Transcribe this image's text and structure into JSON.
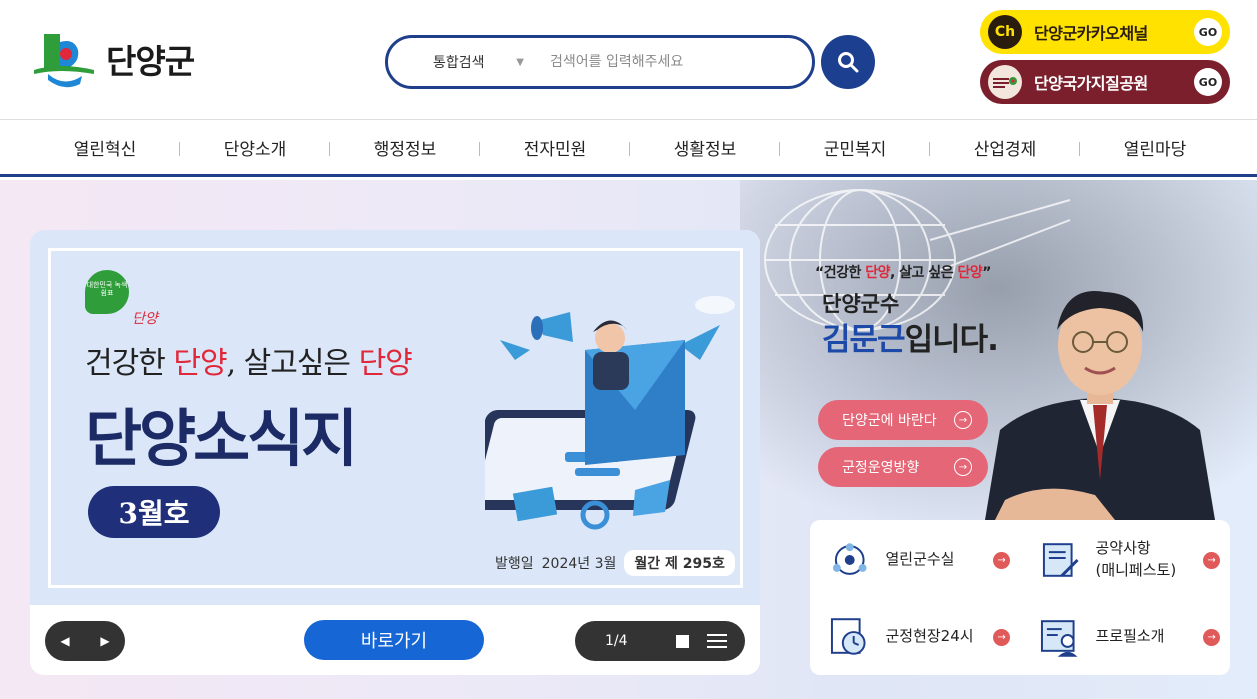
{
  "header": {
    "logo_text": "단양군",
    "search": {
      "category": "통합검색",
      "placeholder": "검색어를 입력해주세요"
    },
    "quick_links": [
      {
        "icon": "Ch",
        "label": "단양군카카오채널",
        "go": "GO"
      },
      {
        "icon": "단양세계지질공원",
        "label": "단양국가지질공원",
        "go": "GO"
      }
    ]
  },
  "nav": {
    "items": [
      "열린혁신",
      "단양소개",
      "행정정보",
      "전자민원",
      "생활정보",
      "군민복지",
      "산업경제",
      "열린마당"
    ]
  },
  "news": {
    "badge": "대한민국 녹색쉼표",
    "badge_sub": "단양",
    "slogan": {
      "p1": "건강한 ",
      "r1": "단양",
      "p2": ", 살고싶은 ",
      "r2": "단양"
    },
    "title": "단양소식지",
    "issue": "3월호",
    "pub_label": "발행일",
    "pub_date": "2024년 3월",
    "volume": "월간 제 295호",
    "goto_label": "바로가기",
    "pager": "1/4"
  },
  "mayor": {
    "quote": {
      "open": "“건강한 ",
      "r1": "단양",
      "mid": ", 살고 싶은 ",
      "r2": "단양",
      "close": "”"
    },
    "subtitle": "단양군수",
    "name_blue": "김문근",
    "name_rest": "입니다.",
    "buttons": [
      "단양군에 바란다",
      "군정운영방향"
    ]
  },
  "links": [
    {
      "label": "열린군수실",
      "icon": "people-circle-icon"
    },
    {
      "label": "공약사항\n(매니페스토)",
      "icon": "document-pen-icon"
    },
    {
      "label": "군정현장24시",
      "icon": "clock-icon"
    },
    {
      "label": "프로필소개",
      "icon": "profile-card-icon"
    }
  ],
  "colors": {
    "primary": "#1f3f8c",
    "kakao": "#ffe200",
    "geopark": "#7a1f2b",
    "accent_red": "#e0283a",
    "pill": "#e56676",
    "goto_blue": "#1766d6"
  }
}
